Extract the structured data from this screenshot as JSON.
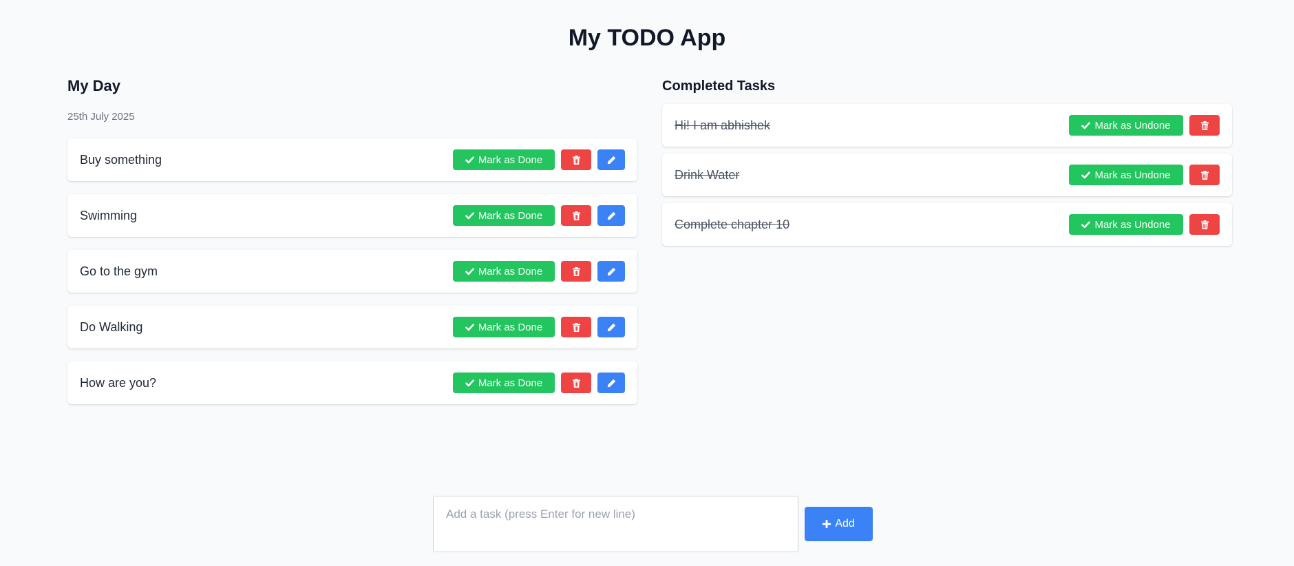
{
  "app": {
    "title": "My TODO App"
  },
  "my_day": {
    "heading": "My Day",
    "date": "25th July 2025",
    "done_label": "Mark as Done",
    "tasks": [
      {
        "text": "Buy something"
      },
      {
        "text": "Swimming"
      },
      {
        "text": "Go to the gym"
      },
      {
        "text": "Do Walking"
      },
      {
        "text": "How are you?"
      }
    ]
  },
  "completed": {
    "heading": "Completed Tasks",
    "undone_label": "Mark as Undone",
    "tasks": [
      {
        "text": "Hi! I am abhishek"
      },
      {
        "text": "Drink Water"
      },
      {
        "text": "Complete chapter 10"
      }
    ]
  },
  "composer": {
    "placeholder": "Add a task (press Enter for new line)",
    "value": "",
    "add_label": "Add"
  },
  "icons": {
    "check": "check-icon",
    "trash": "trash-icon",
    "edit": "pencil-icon",
    "plus": "plus-icon"
  },
  "colors": {
    "background": "#f8fafc",
    "green": "#22c55e",
    "red": "#ef4444",
    "blue": "#3b82f6"
  }
}
